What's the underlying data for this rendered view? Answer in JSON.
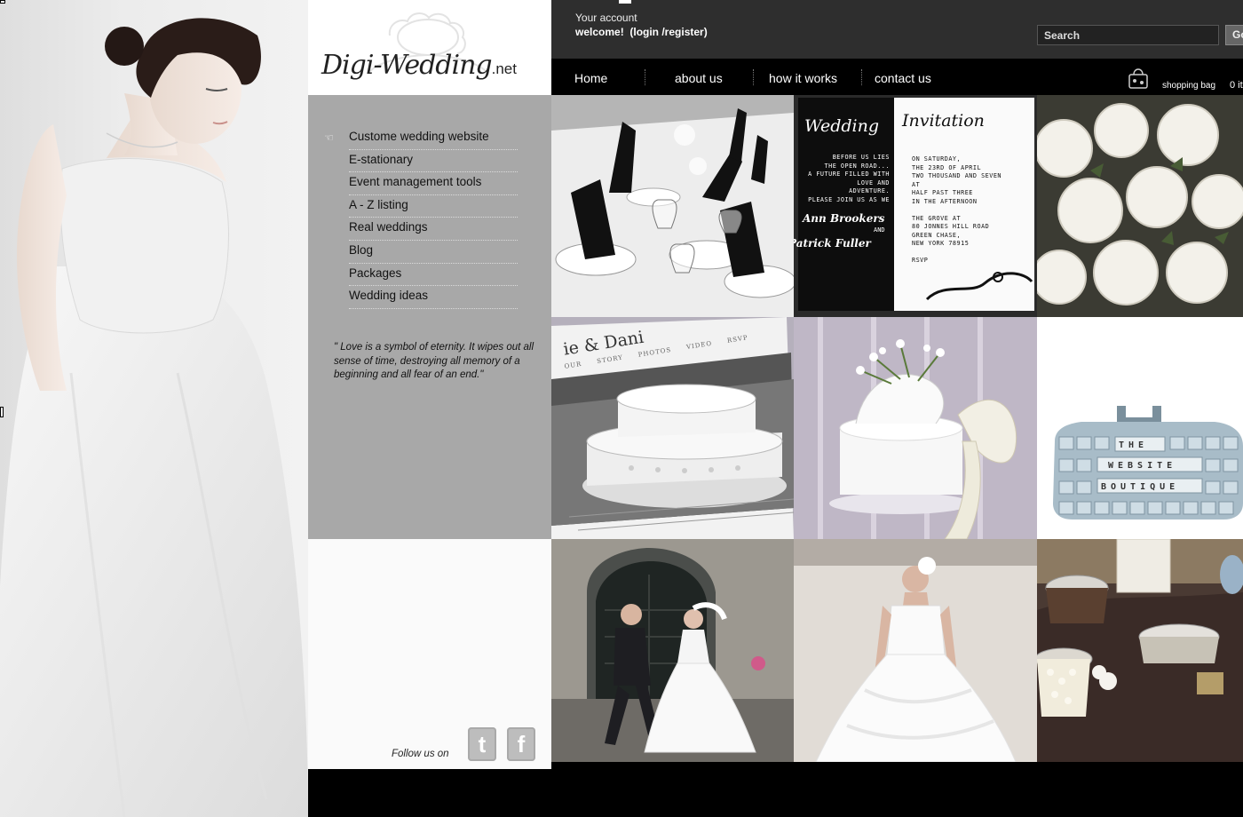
{
  "logo": {
    "main": "Digi-Wedding",
    "suffix": ".net"
  },
  "account": {
    "label": "Your account",
    "welcome": "welcome!",
    "login_link": "(login /register)"
  },
  "search": {
    "placeholder": "Search",
    "go_label": "Go"
  },
  "nav": {
    "items": [
      "Home",
      "about us",
      "how it works",
      "contact us"
    ]
  },
  "bag": {
    "label": "shopping bag",
    "count": "0 it"
  },
  "sidebar": {
    "items": [
      "Custome wedding website",
      "E-stationary",
      "Event management tools",
      "A - Z listing",
      "Real weddings",
      "Blog",
      "Packages",
      "Wedding ideas"
    ],
    "quote": "\" Love is a symbol of eternity.  It wipes out all sense of time, destroying all memory of a beginning and all fear of an end.\""
  },
  "follow": {
    "label": "Follow us on",
    "twitter_glyph": "t",
    "facebook_glyph": "f"
  },
  "invitation": {
    "title_1": "Wedding",
    "title_2": "Invitation",
    "left_lines": [
      "BEFORE US LIES",
      "THE OPEN ROAD...",
      "A FUTURE FILLED WITH",
      "LOVE AND",
      "ADVENTURE.",
      "PLEASE JOIN US AS WE"
    ],
    "right_lines": [
      "ON SATURDAY,",
      "THE 23RD OF APRIL",
      "TWO THOUSAND AND SEVEN",
      "AT",
      "HALF PAST THREE",
      "IN THE AFTERNOON",
      "",
      "THE GROVE AT",
      "80 JONNES HILL ROAD",
      "GREEN CHASE,",
      "NEW YORK 78915",
      "",
      "RSVP"
    ],
    "name_1": "Ann Brookers",
    "and": "AND",
    "name_2": "Patrick Fuller"
  },
  "cake_site": {
    "couple": "ie & Dani",
    "tabs": "OUR STORY PHOTOS VIDEO RSVP"
  },
  "boutique": {
    "lines": [
      "THE",
      "WEBSITE",
      "BOUTIQUE"
    ]
  }
}
